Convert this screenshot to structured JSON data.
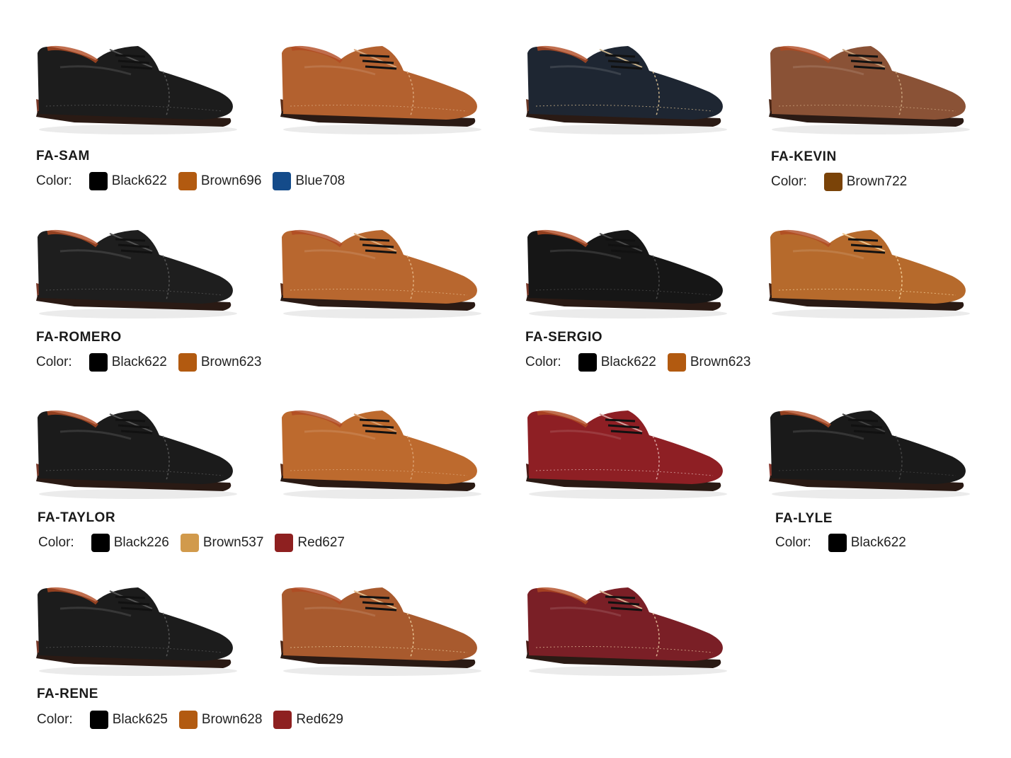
{
  "color_prefix": "Color:",
  "shoes": [
    {
      "color": "#1c1c1c",
      "sole": "#7a3a2a",
      "stitch": "#555555"
    },
    {
      "color": "#b3612f",
      "sole": "#5a2c18",
      "stitch": "#d9a57a"
    },
    {
      "color": "#1e2632",
      "sole": "#6b3a28",
      "stitch": "#c9b28a"
    },
    {
      "color": "#8a5236",
      "sole": "#4a2616",
      "stitch": "#c8a07a"
    },
    {
      "color": "#1e1e1e",
      "sole": "#7a3a2a",
      "stitch": "#555555"
    },
    {
      "color": "#b8672f",
      "sole": "#5a2c18",
      "stitch": "#e0b080"
    },
    {
      "color": "#161616",
      "sole": "#7a3a2a",
      "stitch": "#4a4a4a"
    },
    {
      "color": "#b66a2c",
      "sole": "#4a2616",
      "stitch": "#f0c890"
    },
    {
      "color": "#1b1b1b",
      "sole": "#7a3a2a",
      "stitch": "#555555"
    },
    {
      "color": "#bd6a2e",
      "sole": "#5a2c18",
      "stitch": "#d9a070"
    },
    {
      "color": "#8e1f24",
      "sole": "#4a1a16",
      "stitch": "#d7a3a0"
    },
    {
      "color": "#1a1a1a",
      "sole": "#8a3a30",
      "stitch": "#444444"
    },
    {
      "color": "#1c1c1c",
      "sole": "#7a3a2a",
      "stitch": "#555555"
    },
    {
      "color": "#a85a2e",
      "sole": "#4a2616",
      "stitch": "#e5c090"
    },
    {
      "color": "#7a1f26",
      "sole": "#4a1a16",
      "stitch": "#d9b090"
    }
  ],
  "products": [
    {
      "name": "FA-SAM",
      "colors": [
        {
          "label": "Black622",
          "hex": "#000000"
        },
        {
          "label": "Brown696",
          "hex": "#b25a10"
        },
        {
          "label": "Blue708",
          "hex": "#144b8a"
        }
      ]
    },
    {
      "name": "FA-KEVIN",
      "colors": [
        {
          "label": "Brown722",
          "hex": "#7a4308"
        }
      ]
    },
    {
      "name": "FA-ROMERO",
      "colors": [
        {
          "label": "Black622",
          "hex": "#000000"
        },
        {
          "label": "Brown623",
          "hex": "#b25a10"
        }
      ]
    },
    {
      "name": "FA-SERGIO",
      "colors": [
        {
          "label": "Black622",
          "hex": "#000000"
        },
        {
          "label": "Brown623",
          "hex": "#b25a10"
        }
      ]
    },
    {
      "name": "FA-TAYLOR",
      "colors": [
        {
          "label": "Black226",
          "hex": "#000000"
        },
        {
          "label": "Brown537",
          "hex": "#d19a4c"
        },
        {
          "label": "Red627",
          "hex": "#8e2020"
        }
      ]
    },
    {
      "name": "FA-LYLE",
      "colors": [
        {
          "label": "Black622",
          "hex": "#000000"
        }
      ]
    },
    {
      "name": "FA-RENE",
      "colors": [
        {
          "label": "Black625",
          "hex": "#000000"
        },
        {
          "label": "Brown628",
          "hex": "#b25a10"
        },
        {
          "label": "Red629",
          "hex": "#8e2020"
        }
      ]
    }
  ]
}
